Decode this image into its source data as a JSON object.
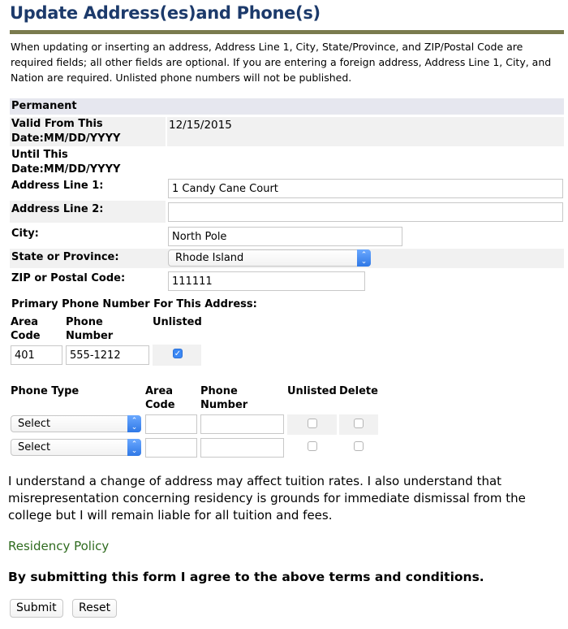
{
  "page": {
    "title": "Update Address(es)and Phone(s)",
    "intro": "When updating or inserting an address, Address Line 1, City, State/Province, and ZIP/Postal Code are required fields; all other fields are optional. If you are entering a foreign address, Address Line 1, City, and Nation are required. Unlisted phone numbers will not be published."
  },
  "address": {
    "section_title": "Permanent",
    "valid_from_label_1": "Valid From This",
    "valid_from_label_2": "Date:MM/DD/YYYY",
    "valid_from_value": "12/15/2015",
    "until_label_1": "Until This",
    "until_label_2": "Date:MM/DD/YYYY",
    "line1_label": "Address Line 1:",
    "line1_value": "1 Candy Cane Court",
    "line2_label": "Address Line 2:",
    "line2_value": "",
    "city_label": "City:",
    "city_value": "North Pole",
    "state_label": "State or Province:",
    "state_value": "Rhode Island",
    "zip_label": "ZIP or Postal Code:",
    "zip_value": "111111"
  },
  "primary_phone": {
    "heading": "Primary Phone Number For This Address:",
    "area_code_label_1": "Area",
    "area_code_label_2": "Code",
    "phone_label_1": "Phone",
    "phone_label_2": "Number",
    "unlisted_label": "Unlisted",
    "area_code_value": "401",
    "phone_value": "555-1212",
    "unlisted_checked": true
  },
  "other_phones": {
    "headers": {
      "phone_type": "Phone Type",
      "area_code_1": "Area",
      "area_code_2": "Code",
      "phone_1": "Phone",
      "phone_2": "Number",
      "unlisted": "Unlisted",
      "delete": "Delete"
    },
    "rows": [
      {
        "type": "Select",
        "area_code": "",
        "phone": "",
        "unlisted": false,
        "delete": false
      },
      {
        "type": "Select",
        "area_code": "",
        "phone": "",
        "unlisted": false,
        "delete": false
      }
    ]
  },
  "terms": {
    "paragraph": "I understand a change of address may affect tuition rates. I also understand that misrepresentation concerning residency is grounds for immediate dismissal from the college but I will remain liable for all tuition and fees.",
    "policy_link": "Residency Policy",
    "agreement": "By submitting this form I agree to the above terms and conditions."
  },
  "buttons": {
    "submit": "Submit",
    "reset": "Reset"
  },
  "icons": {
    "select_arrow": "updown-chevron-icon",
    "check": "checkmark-icon"
  },
  "colors": {
    "title": "#1c3a6b",
    "rule": "#7a7b4e",
    "link": "#2f6b1f",
    "select_accent": "#3b88f4"
  }
}
